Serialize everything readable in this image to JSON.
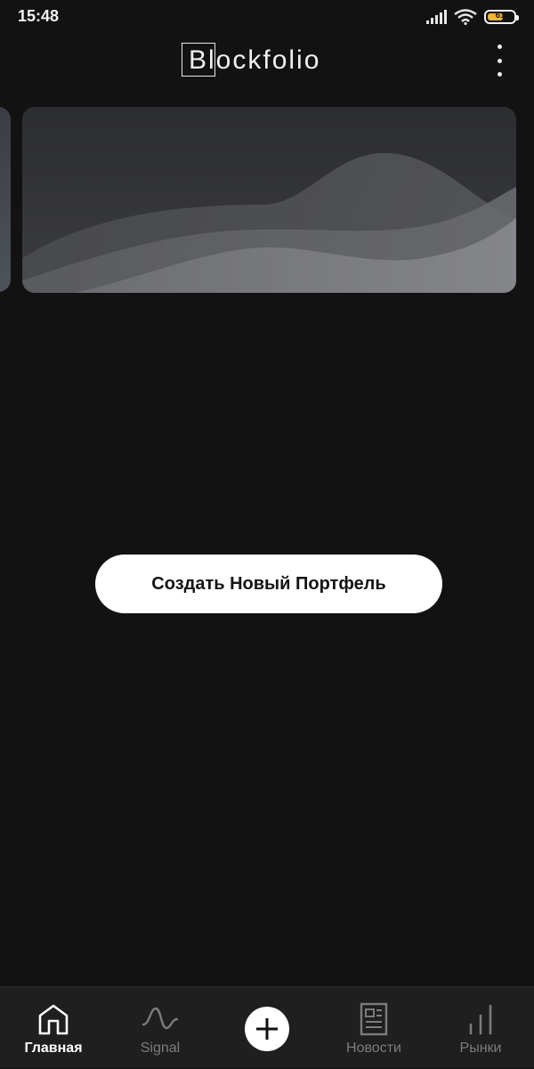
{
  "status_bar": {
    "time": "15:48",
    "battery_level": "61",
    "battery_fraction": 0.61,
    "icons": [
      "signal-icon",
      "wifi-icon",
      "battery-icon"
    ]
  },
  "header": {
    "logo": "Blockfolio",
    "menu_icon": "more-vertical-icon"
  },
  "main": {
    "create_portfolio_label": "Создать Новый Портфель"
  },
  "bottom_nav": {
    "items": [
      {
        "label": "Главная",
        "icon": "home-icon",
        "active": true
      },
      {
        "label": "Signal",
        "icon": "signal-wave-icon",
        "active": false
      },
      {
        "label": "",
        "icon": "plus-icon",
        "active": false
      },
      {
        "label": "Новости",
        "icon": "news-icon",
        "active": false
      },
      {
        "label": "Рынки",
        "icon": "bar-chart-icon",
        "active": false
      }
    ]
  },
  "colors": {
    "background": "#121212",
    "nav_background": "#1f1f1f",
    "button_background": "#ffffff",
    "battery_accent": "#f2b632",
    "inactive_label": "#7c7c7c"
  }
}
